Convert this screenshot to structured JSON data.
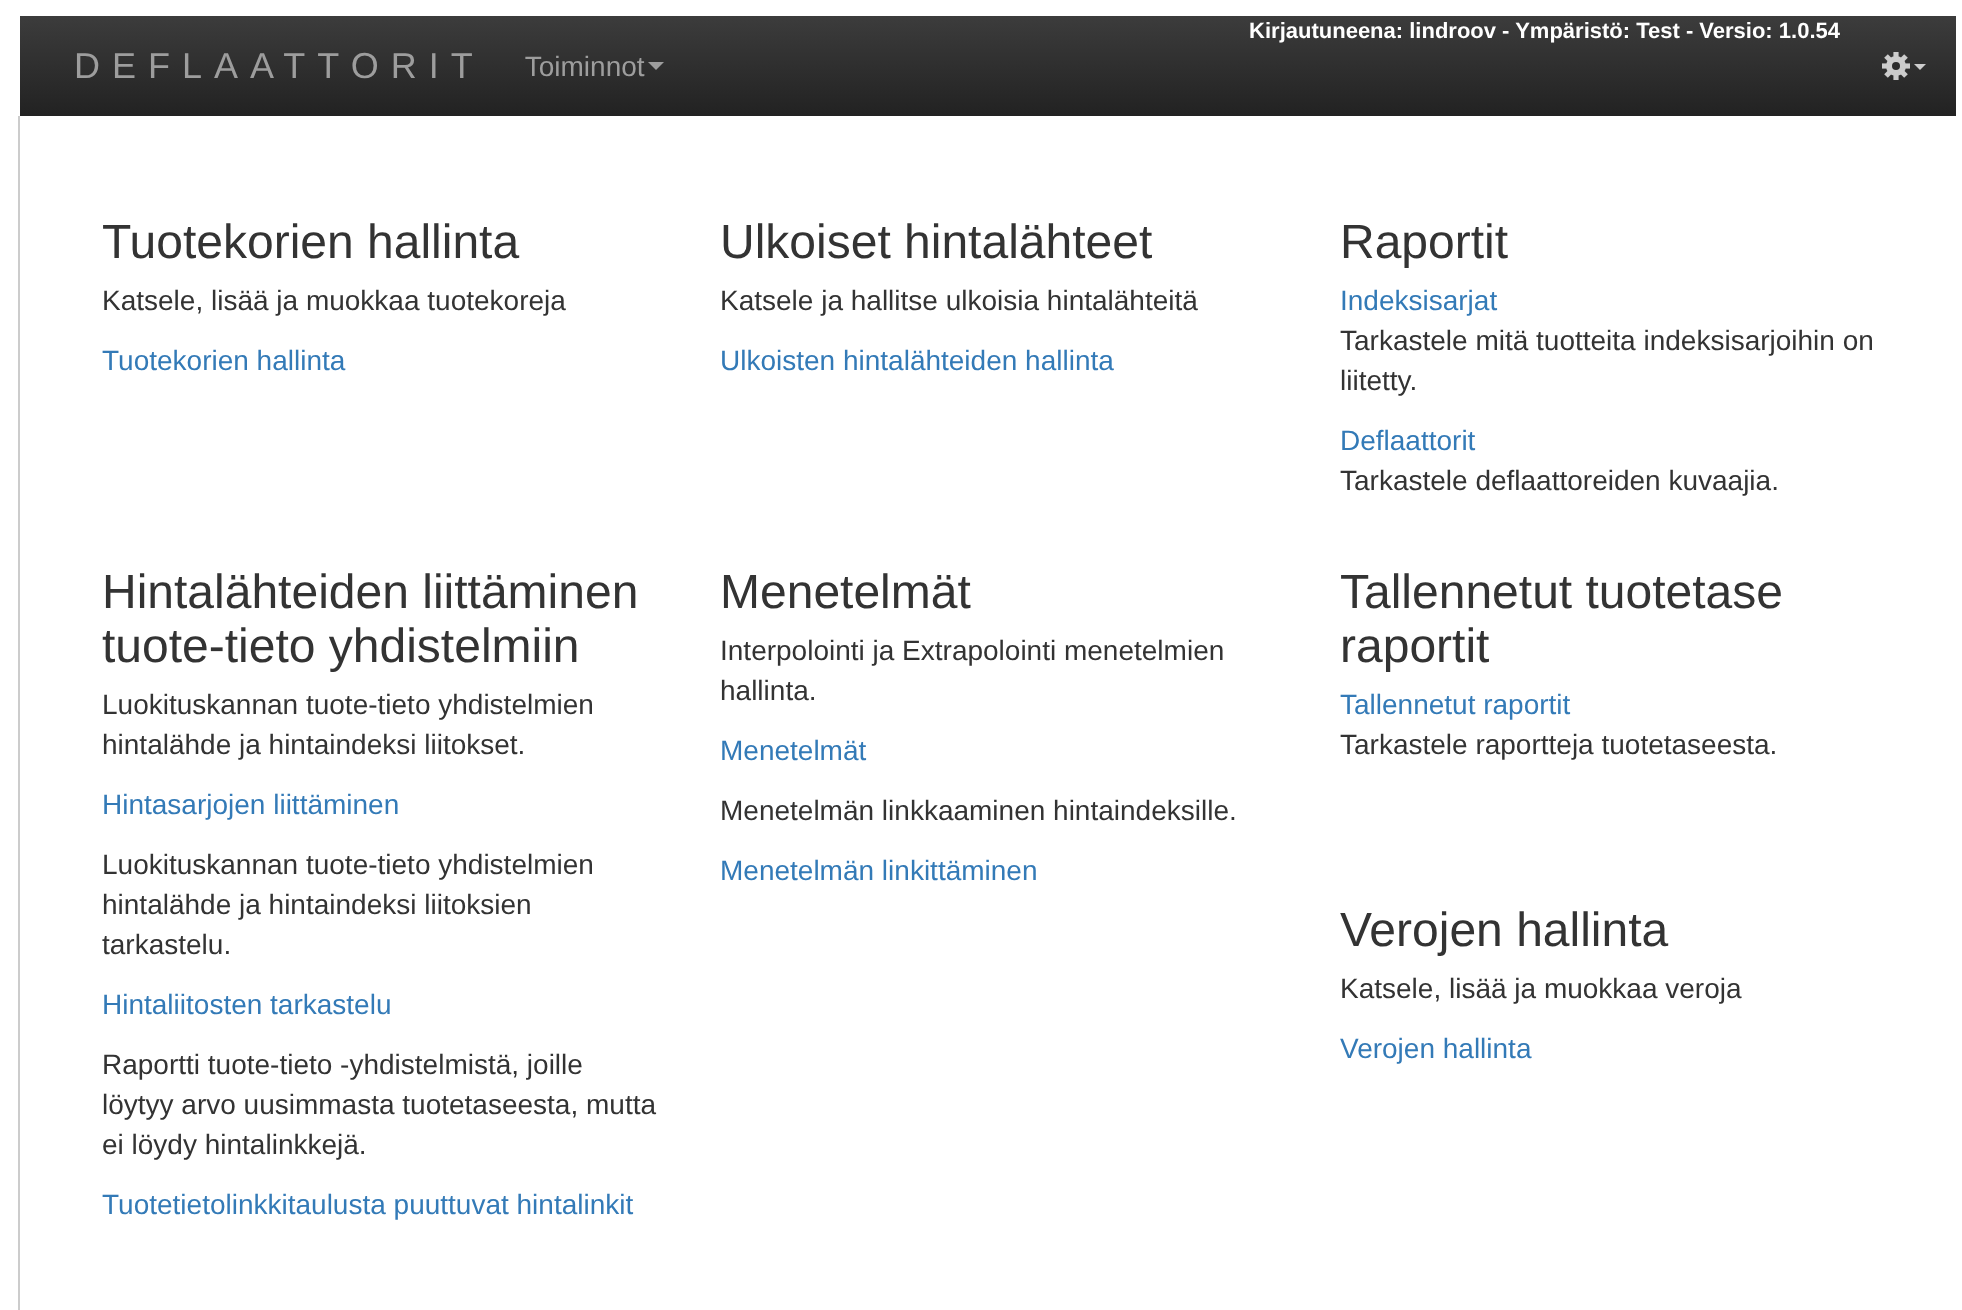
{
  "navbar": {
    "brand": "DEFLAATTORIT",
    "menu": {
      "label": "Toiminnot"
    },
    "session_info": "Kirjautuneena: lindroov - Ympäristö: Test - Versio: 1.0.54"
  },
  "columns": [
    {
      "sections": [
        {
          "title": "Tuotekorien hallinta",
          "blocks": [
            [
              {
                "kind": "text",
                "text": "Katsele, lisää ja muokkaa tuotekoreja"
              },
              {
                "kind": "link",
                "text": "Tuotekorien hallinta"
              }
            ]
          ]
        },
        {
          "title": "Hintalähteiden liittäminen tuote-tieto yhdistelmiin",
          "blocks": [
            [
              {
                "kind": "text",
                "text": "Luokituskannan tuote-tieto yhdistelmien hintalähde ja hintaindeksi liitokset."
              },
              {
                "kind": "link",
                "text": "Hintasarjojen liittäminen"
              }
            ],
            [
              {
                "kind": "text",
                "text": "Luokituskannan tuote-tieto yhdistelmien hintalähde ja hintaindeksi liitoksien tarkastelu."
              },
              {
                "kind": "link",
                "text": "Hintaliitosten tarkastelu"
              }
            ],
            [
              {
                "kind": "text",
                "text": "Raportti tuote-tieto -yhdistelmistä, joille löytyy arvo uusimmasta tuotetaseesta, mutta ei löydy hintalinkkejä."
              },
              {
                "kind": "link",
                "text": "Tuotetietolinkkitaulusta puuttuvat hintalinkit"
              }
            ]
          ]
        }
      ]
    },
    {
      "sections": [
        {
          "title": "Ulkoiset hintalähteet",
          "blocks": [
            [
              {
                "kind": "text",
                "text": "Katsele ja hallitse ulkoisia hintalähteitä"
              },
              {
                "kind": "link",
                "text": "Ulkoisten hintalähteiden hallinta"
              }
            ]
          ]
        },
        {
          "title": "Menetelmät",
          "blocks": [
            [
              {
                "kind": "text",
                "text": "Interpolointi ja Extrapolointi menetelmien hallinta."
              },
              {
                "kind": "link",
                "text": "Menetelmät"
              }
            ],
            [
              {
                "kind": "text",
                "text": "Menetelmän linkkaaminen hintaindeksille."
              },
              {
                "kind": "link",
                "text": "Menetelmän linkittäminen"
              }
            ]
          ]
        }
      ]
    },
    {
      "sections": [
        {
          "title": "Raportit",
          "blocks": [
            [
              {
                "kind": "link",
                "text": "Indeksisarjat"
              },
              {
                "kind": "text",
                "text": "Tarkastele mitä tuotteita indeksisarjoihin on liitetty."
              }
            ],
            [
              {
                "kind": "link",
                "text": "Deflaattorit"
              },
              {
                "kind": "text",
                "text": "Tarkastele deflaattoreiden kuvaajia."
              }
            ]
          ]
        },
        {
          "title": "Tallennetut tuotetase raportit",
          "blocks": [
            [
              {
                "kind": "link",
                "text": "Tallennetut raportit"
              },
              {
                "kind": "text",
                "text": "Tarkastele raportteja tuotetaseesta."
              }
            ]
          ]
        },
        {
          "title": "Verojen hallinta",
          "blocks": [
            [
              {
                "kind": "text",
                "text": "Katsele, lisää ja muokkaa veroja"
              },
              {
                "kind": "link",
                "text": "Verojen hallinta"
              }
            ]
          ]
        }
      ]
    }
  ]
}
